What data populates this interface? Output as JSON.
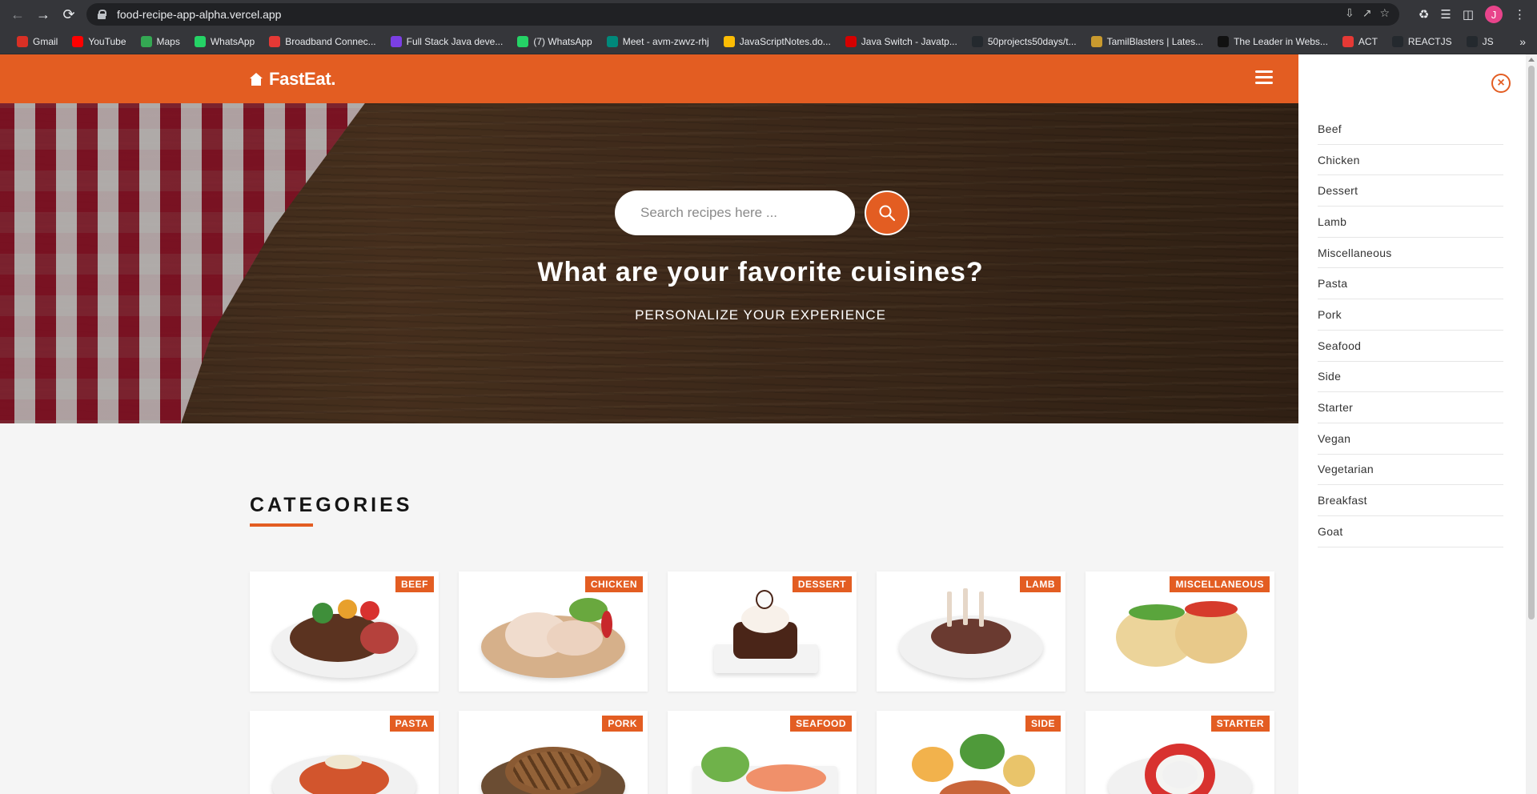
{
  "browser": {
    "url": "food-recipe-app-alpha.vercel.app",
    "profile_initial": "J",
    "bookmarks": [
      {
        "label": "Gmail",
        "icon": "gmail-icon",
        "color": "#d93025"
      },
      {
        "label": "YouTube",
        "icon": "youtube-icon",
        "color": "#ff0000"
      },
      {
        "label": "Maps",
        "icon": "maps-icon",
        "color": "#34a853"
      },
      {
        "label": "WhatsApp",
        "icon": "whatsapp-icon",
        "color": "#25d366"
      },
      {
        "label": "Broadband Connec...",
        "icon": "broadband-icon",
        "color": "#e53935"
      },
      {
        "label": "Full Stack Java deve...",
        "icon": "java-course-icon",
        "color": "#7b3fe4"
      },
      {
        "label": "(7) WhatsApp",
        "icon": "whatsapp-icon",
        "color": "#25d366"
      },
      {
        "label": "Meet - avm-zwvz-rhj",
        "icon": "meet-icon",
        "color": "#00897b"
      },
      {
        "label": "JavaScriptNotes.do...",
        "icon": "drive-icon",
        "color": "#fbbc04"
      },
      {
        "label": "Java Switch - Javatp...",
        "icon": "javatpoint-icon",
        "color": "#d50000"
      },
      {
        "label": "50projects50days/t...",
        "icon": "github-icon",
        "color": "#24292e"
      },
      {
        "label": "TamilBlasters | Lates...",
        "icon": "tamilblasters-icon",
        "color": "#c99a2e"
      },
      {
        "label": "The Leader in Webs...",
        "icon": "wix-icon",
        "color": "#111111"
      },
      {
        "label": "ACT",
        "icon": "act-icon",
        "color": "#e53935"
      },
      {
        "label": "REACTJS",
        "icon": "github-icon",
        "color": "#24292e"
      },
      {
        "label": "JS",
        "icon": "github-icon",
        "color": "#24292e"
      }
    ]
  },
  "navbar": {
    "brand": "FastEat.",
    "brand_color": "#e35d22"
  },
  "hero": {
    "search_placeholder": "Search recipes here ...",
    "title": "What are your favorite cuisines?",
    "subtitle": "PERSONALIZE YOUR EXPERIENCE"
  },
  "categories": {
    "heading": "CATEGORIES",
    "items": [
      {
        "label": "BEEF"
      },
      {
        "label": "CHICKEN"
      },
      {
        "label": "DESSERT"
      },
      {
        "label": "LAMB"
      },
      {
        "label": "MISCELLANEOUS"
      },
      {
        "label": "PASTA"
      },
      {
        "label": "PORK"
      },
      {
        "label": "SEAFOOD"
      },
      {
        "label": "SIDE"
      },
      {
        "label": "STARTER"
      }
    ]
  },
  "drawer": {
    "close_icon": "close-circle-icon",
    "items": [
      "Beef",
      "Chicken",
      "Dessert",
      "Lamb",
      "Miscellaneous",
      "Pasta",
      "Pork",
      "Seafood",
      "Side",
      "Starter",
      "Vegan",
      "Vegetarian",
      "Breakfast",
      "Goat"
    ]
  }
}
